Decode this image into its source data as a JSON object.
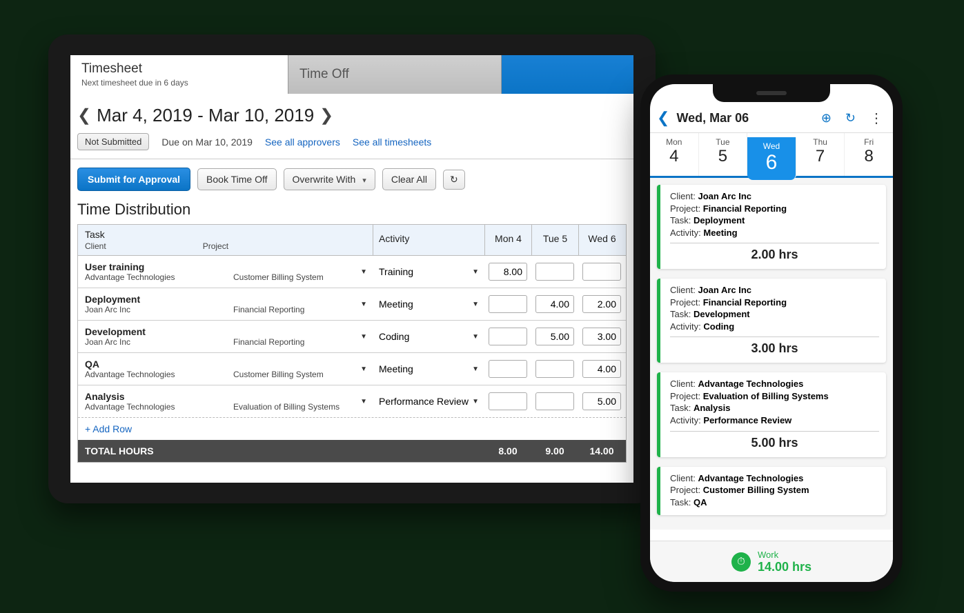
{
  "tablet": {
    "tabs": {
      "timesheet": {
        "label": "Timesheet",
        "sub": "Next timesheet due in 6 days"
      },
      "timeoff": {
        "label": "Time Off"
      }
    },
    "period": {
      "title": "Mar 4, 2019 - Mar 10, 2019"
    },
    "status": {
      "badge": "Not Submitted",
      "due": "Due on Mar 10, 2019",
      "approvers_link": "See all approvers",
      "timesheets_link": "See all timesheets"
    },
    "toolbar": {
      "submit": "Submit for Approval",
      "book": "Book Time Off",
      "overwrite": "Overwrite With",
      "clear": "Clear All"
    },
    "dist_heading": "Time Distribution",
    "headers": {
      "task": "Task",
      "client": "Client",
      "project": "Project",
      "activity": "Activity",
      "d1": "Mon 4",
      "d2": "Tue 5",
      "d3": "Wed 6"
    },
    "rows": [
      {
        "task": "User training",
        "client": "Advantage Technologies",
        "project": "Customer Billing System",
        "activity": "Training",
        "d1": "8.00",
        "d2": "",
        "d3": ""
      },
      {
        "task": "Deployment",
        "client": "Joan Arc Inc",
        "project": "Financial Reporting",
        "activity": "Meeting",
        "d1": "",
        "d2": "4.00",
        "d3": "2.00"
      },
      {
        "task": "Development",
        "client": "Joan Arc Inc",
        "project": "Financial Reporting",
        "activity": "Coding",
        "d1": "",
        "d2": "5.00",
        "d3": "3.00"
      },
      {
        "task": "QA",
        "client": "Advantage Technologies",
        "project": "Customer Billing System",
        "activity": "Meeting",
        "d1": "",
        "d2": "",
        "d3": "4.00"
      },
      {
        "task": "Analysis",
        "client": "Advantage Technologies",
        "project": "Evaluation of Billing Systems",
        "activity": "Performance Review",
        "d1": "",
        "d2": "",
        "d3": "5.00"
      }
    ],
    "add_row": "+ Add Row",
    "totals": {
      "label": "TOTAL HOURS",
      "d1": "8.00",
      "d2": "9.00",
      "d3": "14.00"
    }
  },
  "phone": {
    "header": {
      "title": "Wed, Mar 06"
    },
    "week": [
      {
        "dow": "Mon",
        "num": "4",
        "sel": false
      },
      {
        "dow": "Tue",
        "num": "5",
        "sel": false
      },
      {
        "dow": "Wed",
        "num": "6",
        "sel": true
      },
      {
        "dow": "Thu",
        "num": "7",
        "sel": false
      },
      {
        "dow": "Fri",
        "num": "8",
        "sel": false
      }
    ],
    "cards": [
      {
        "client": "Joan Arc Inc",
        "project": "Financial Reporting",
        "task": "Deployment",
        "activity": "Meeting",
        "hours": "2.00 hrs"
      },
      {
        "client": "Joan Arc Inc",
        "project": "Financial Reporting",
        "task": "Development",
        "activity": "Coding",
        "hours": "3.00 hrs"
      },
      {
        "client": "Advantage Technologies",
        "project": "Evaluation of Billing Systems",
        "task": "Analysis",
        "activity": "Performance Review",
        "hours": "5.00 hrs"
      },
      {
        "client": "Advantage Technologies",
        "project": "Customer Billing System",
        "task": "QA",
        "activity": "",
        "hours": ""
      }
    ],
    "labels": {
      "client": "Client:",
      "project": "Project:",
      "task": "Task:",
      "activity": "Activity:"
    },
    "footer": {
      "label": "Work",
      "hours": "14.00 hrs"
    }
  }
}
